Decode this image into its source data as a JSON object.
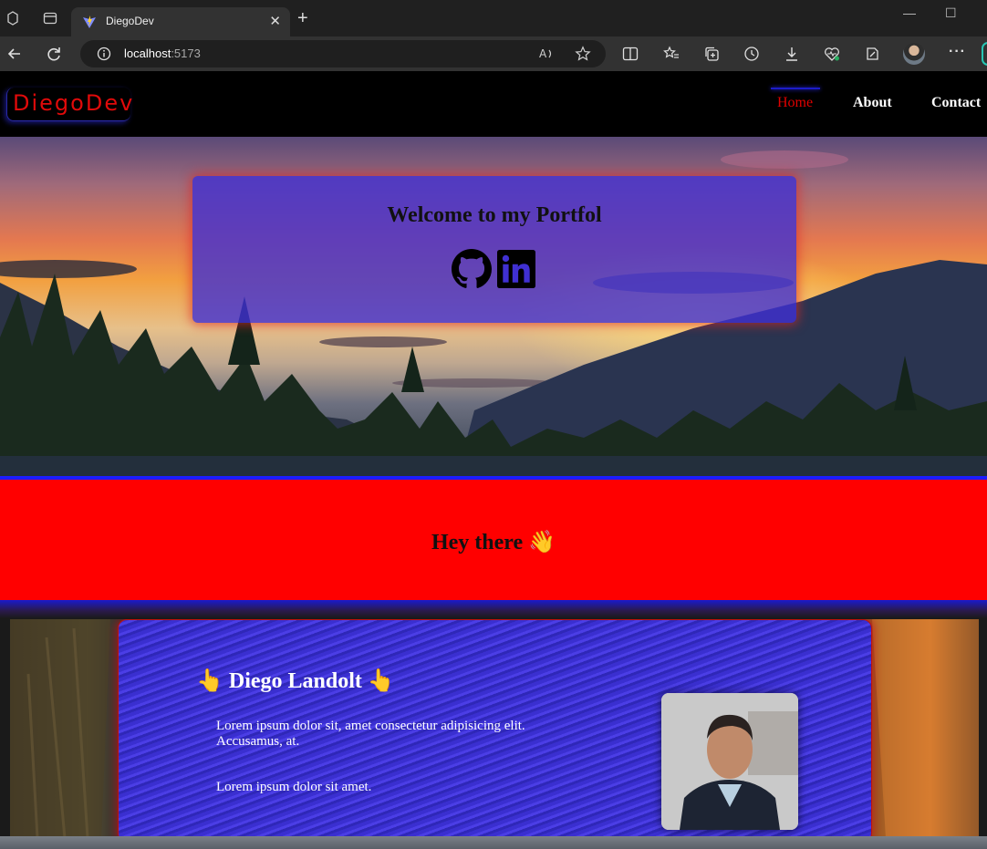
{
  "browser": {
    "tab_title": "DiegoDev",
    "tab_close": "✕",
    "new_tab": "+",
    "minimize": "—",
    "maximize": "☐",
    "address_host": "localhost",
    "address_port": ":5173",
    "more_menu": "···"
  },
  "site": {
    "logo": "DiegoDev",
    "nav": [
      "Home",
      "About",
      "Contact"
    ],
    "active_nav": "Home",
    "hero_title": "Welcome to my Portfol",
    "hey_text": "Hey there 👋",
    "about": {
      "name": "👆 Diego Landolt 👆",
      "paragraph_1": "Lorem ipsum dolor sit, amet consectetur adipisicing elit. Accusamus, at.",
      "paragraph_2": "Lorem ipsum dolor sit amet."
    }
  },
  "colors": {
    "accent_red": "#ff0000",
    "card_blue": "#4030d2",
    "nav_bg": "#000000"
  },
  "icons": [
    "github-icon",
    "linkedin-icon"
  ]
}
